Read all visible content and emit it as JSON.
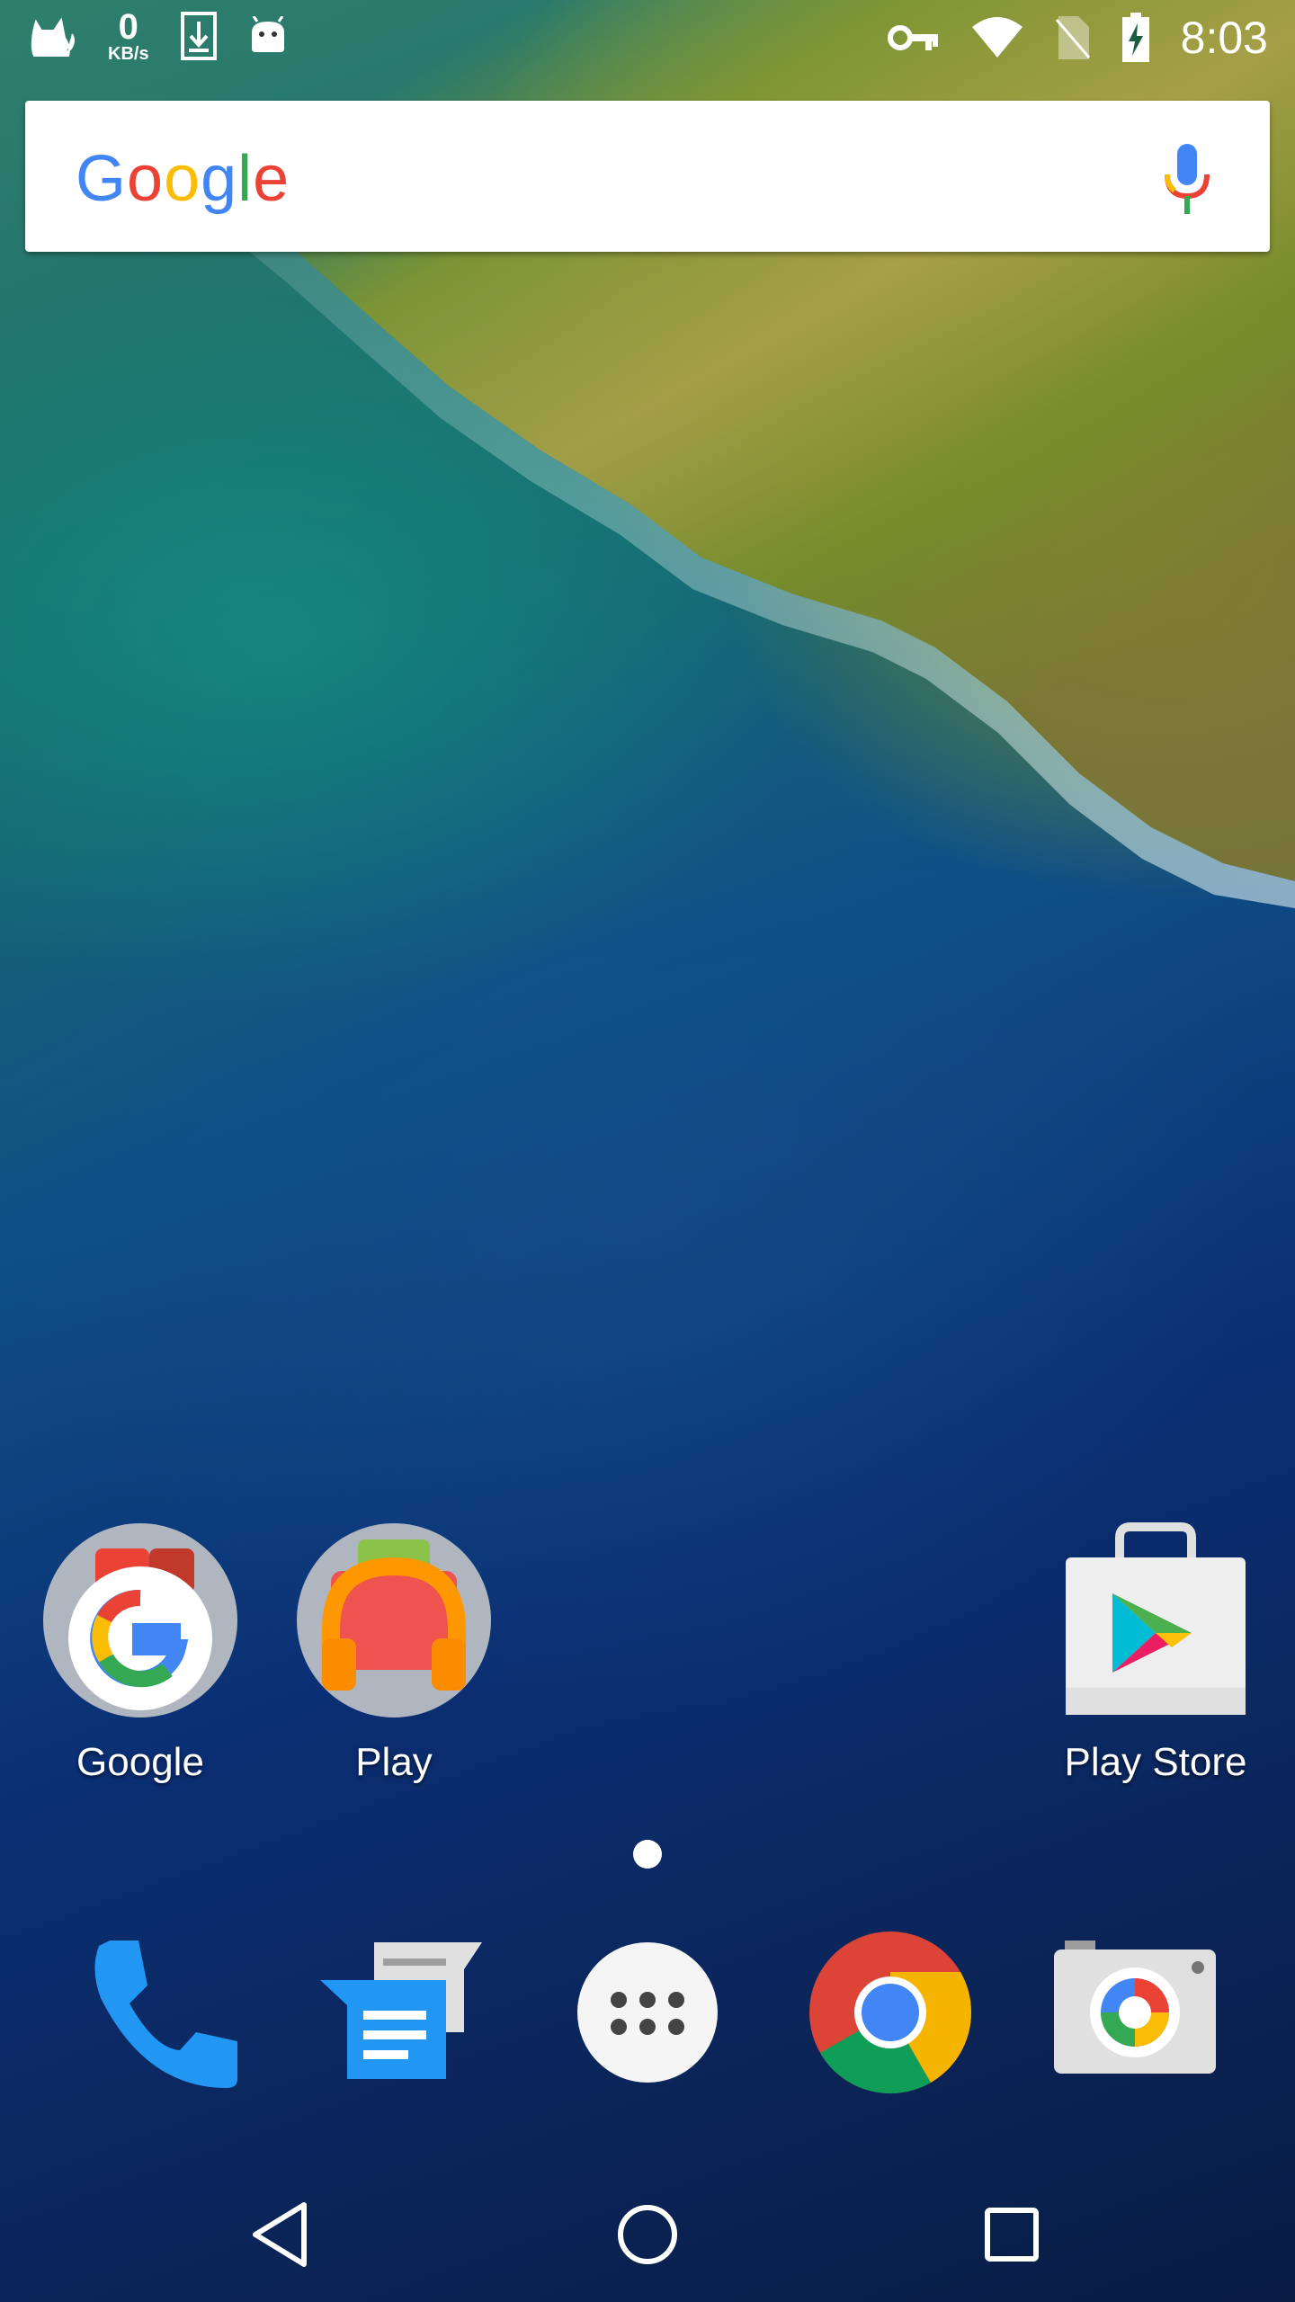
{
  "status_bar": {
    "left_icons": [
      "cat-notification-icon",
      "download-icon",
      "android-icon"
    ],
    "net_speed_value": "0",
    "net_speed_unit": "KB/s",
    "right_icons": [
      "vpn-key-icon",
      "wifi-icon",
      "no-sim-icon",
      "battery-charging-icon"
    ],
    "time": "8:03"
  },
  "search": {
    "logo_letters": [
      "G",
      "o",
      "o",
      "g",
      "l",
      "e"
    ],
    "logo_colors": [
      "#4285F4",
      "#EA4335",
      "#FBBC05",
      "#4285F4",
      "#34A853",
      "#EA4335"
    ],
    "mic_icon": "mic-icon"
  },
  "home_apps": [
    {
      "label": "Google",
      "icon": "google-folder-icon"
    },
    {
      "label": "Play",
      "icon": "play-music-folder-icon"
    },
    {
      "label": "Play Store",
      "icon": "play-store-icon"
    }
  ],
  "page_indicator": {
    "current": 1,
    "total": 1
  },
  "dock": [
    {
      "name": "phone",
      "icon": "phone-icon"
    },
    {
      "name": "messages",
      "icon": "messages-icon"
    },
    {
      "name": "app drawer",
      "icon": "app-drawer-icon"
    },
    {
      "name": "chrome",
      "icon": "chrome-icon"
    },
    {
      "name": "camera",
      "icon": "camera-icon"
    }
  ],
  "nav": [
    "back-icon",
    "home-icon",
    "recents-icon"
  ]
}
